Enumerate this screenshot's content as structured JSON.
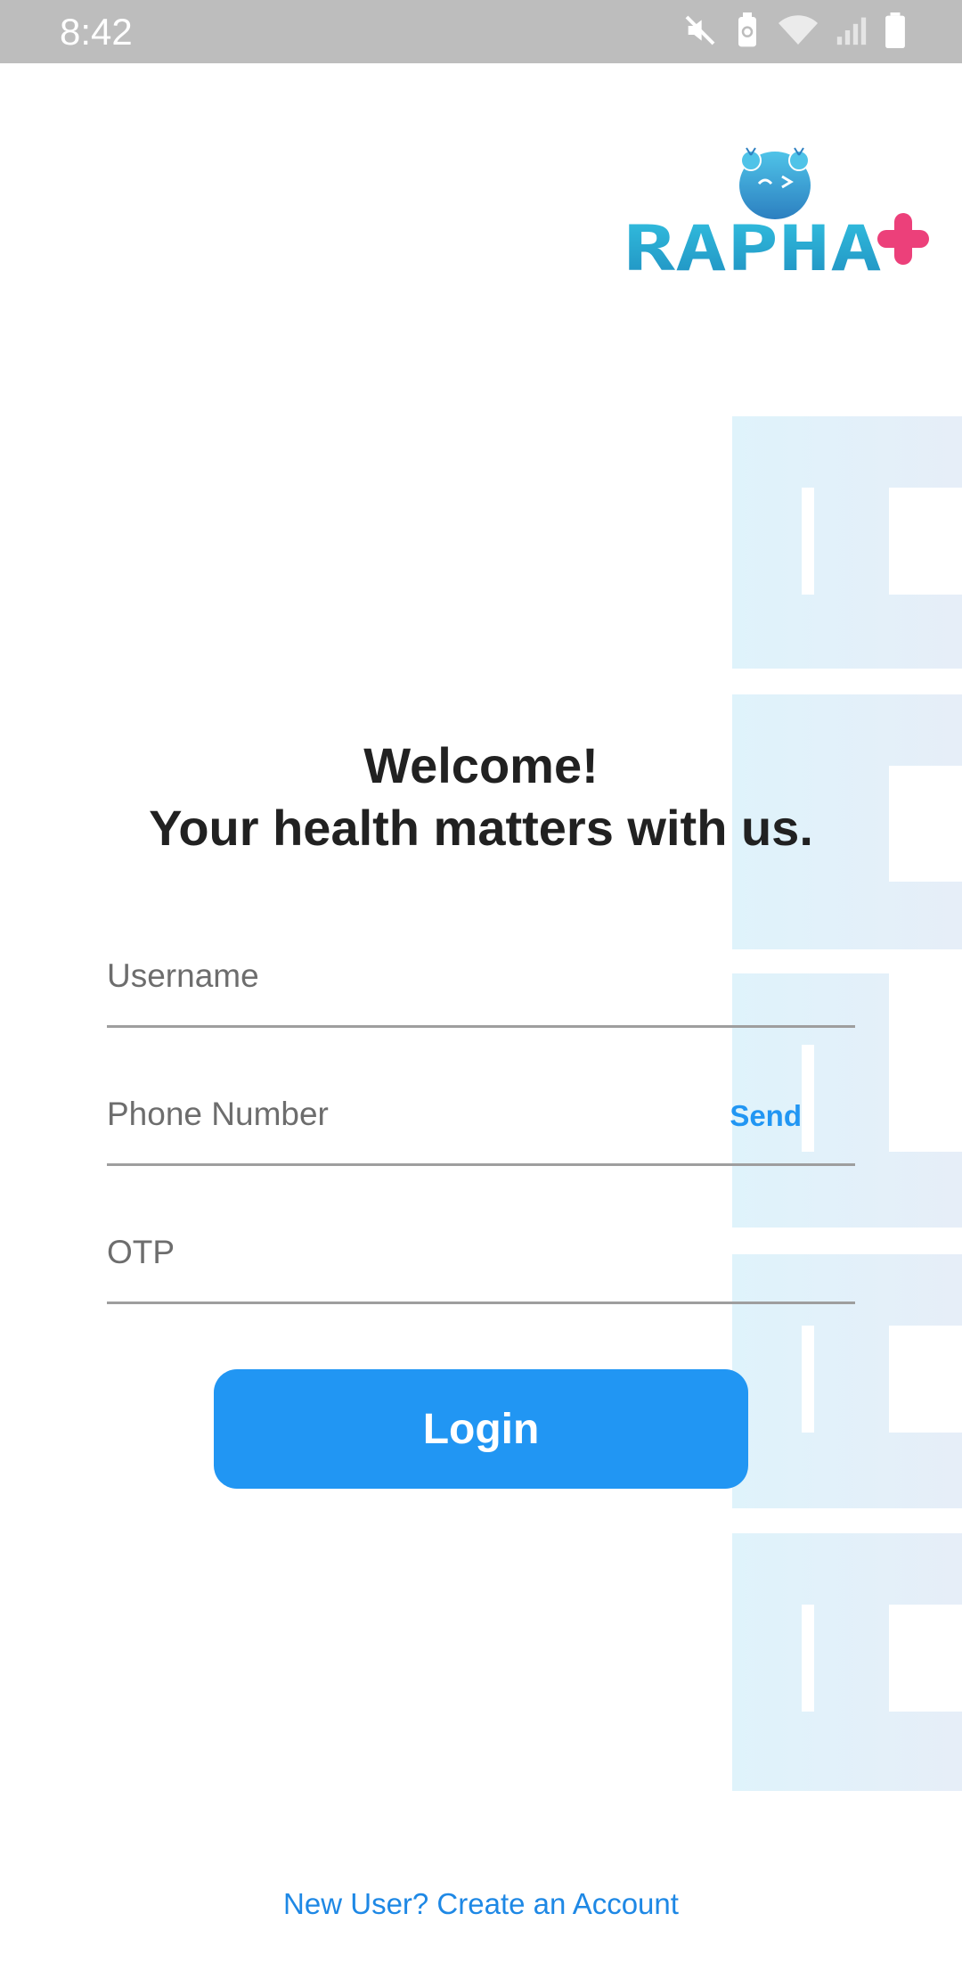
{
  "status_bar": {
    "time": "8:42",
    "icons": [
      "mute-icon",
      "battery-saver-icon",
      "wifi-icon",
      "signal-icon",
      "battery-icon"
    ]
  },
  "logo": {
    "brand_text": "RAPHA+",
    "mascot": "robot-mascot",
    "colors": {
      "text": "#2bb3d8",
      "plus": "#ec407a"
    }
  },
  "welcome": {
    "line1": "Welcome!",
    "line2": "Your health matters with us."
  },
  "form": {
    "username_placeholder": "Username",
    "phone_placeholder": "Phone Number",
    "send_label": "Send",
    "otp_placeholder": "OTP",
    "login_label": "Login"
  },
  "footer": {
    "create_account": "New User? Create an Account"
  },
  "colors": {
    "accent": "#2196f3",
    "status_bar": "#bdbdbd",
    "watermark": "#e1f3fa"
  }
}
